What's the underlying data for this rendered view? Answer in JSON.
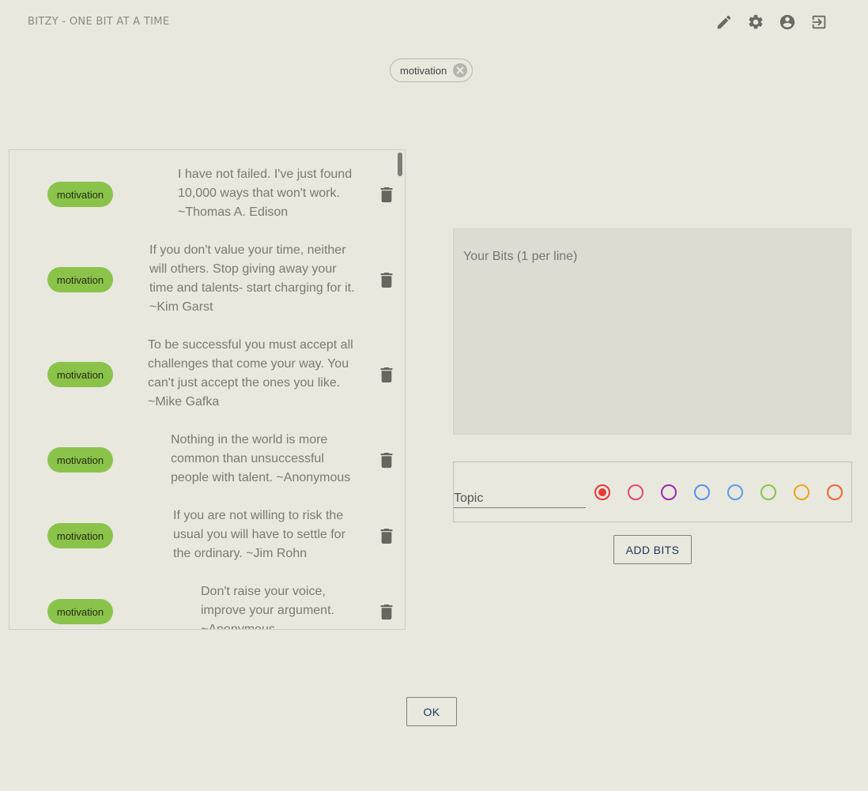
{
  "header": {
    "app_title": "BITZY - ONE BIT AT A TIME",
    "icons": [
      "edit-icon",
      "settings-icon",
      "account-icon",
      "logout-icon"
    ]
  },
  "filter": {
    "active_tag": "motivation"
  },
  "bits": [
    {
      "tag": "motivation",
      "text": [
        "I have not failed. I've just found",
        "10,000 ways that won't work.",
        "~Thomas A. Edison"
      ]
    },
    {
      "tag": "motivation",
      "text": [
        "If you don't value your time, neither",
        "will others. Stop giving away your",
        "time and talents- start charging for it.",
        "~Kim Garst"
      ]
    },
    {
      "tag": "motivation",
      "text": [
        "To be successful you must accept all",
        "challenges that come your way. You",
        "can't just accept the ones you like.",
        "~Mike Gafka"
      ]
    },
    {
      "tag": "motivation",
      "text": [
        "Nothing in the world is more",
        "common than unsuccessful",
        "people with talent. ~Anonymous"
      ]
    },
    {
      "tag": "motivation",
      "text": [
        "If you are not willing to risk the",
        "usual you will have to settle for",
        "the ordinary. ~Jim Rohn"
      ]
    },
    {
      "tag": "motivation",
      "text": [
        "Don't raise your voice,",
        "improve your argument.",
        "~Anonymous"
      ]
    }
  ],
  "editor": {
    "placeholder": "Your Bits (1 per line)",
    "topic_placeholder": "Topic",
    "colors": [
      "#e53935",
      "#e04a6a",
      "#9c27b0",
      "#5b8fe8",
      "#5b9be8",
      "#8bc34a",
      "#f0a020",
      "#ef6430"
    ],
    "selected_color_index": 0,
    "add_label": "ADD BITS"
  },
  "footer": {
    "ok_label": "OK"
  }
}
